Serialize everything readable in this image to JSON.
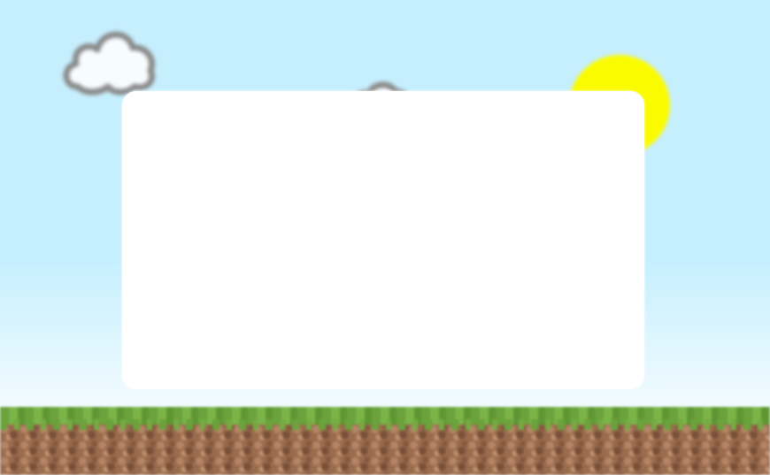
{
  "scene": {
    "sky_color": "#c6effe",
    "sun_color": "#fbfb00",
    "cloud_fill": "#f7fcff",
    "cloud_outline": "#8a8a8a",
    "grass_color": "#6aa23c",
    "dirt_color": "#9a6b4d"
  },
  "dialog": {
    "background": "#ffffff",
    "text": ""
  }
}
